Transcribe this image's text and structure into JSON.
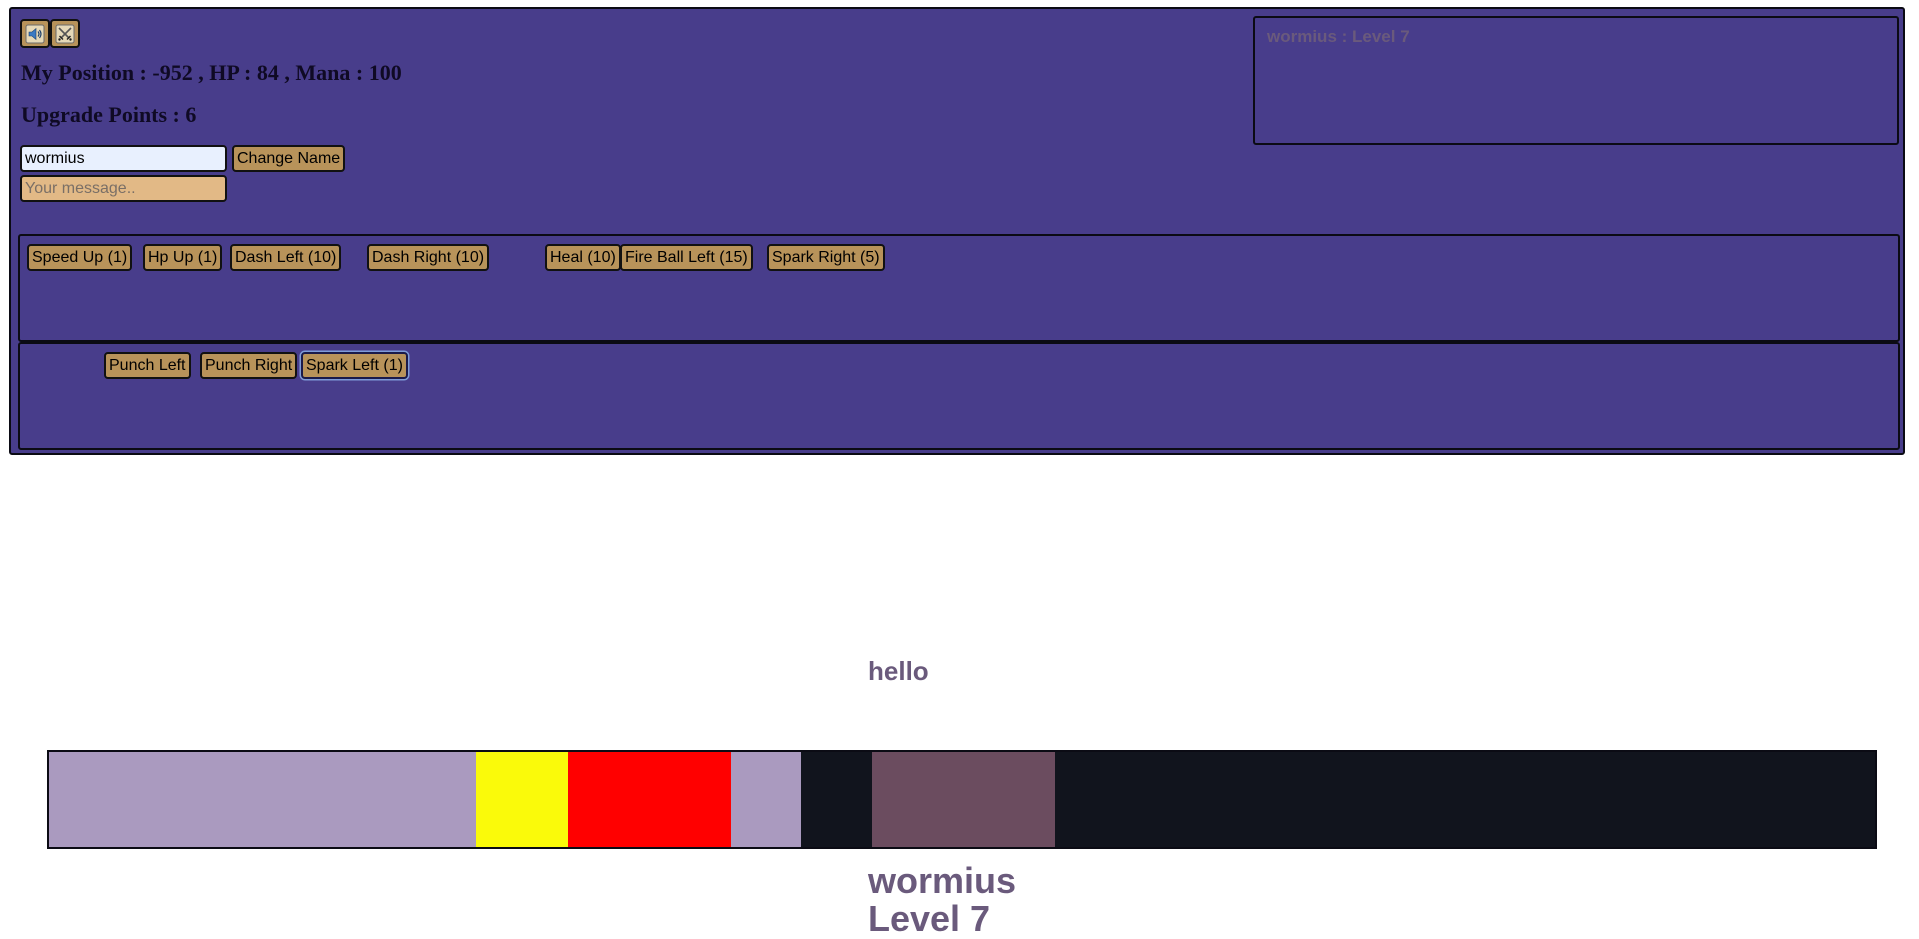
{
  "hud": {
    "sound_icon": "speaker-icon",
    "combat_icon": "crossed-swords-icon",
    "position_line": "My Position : -952 , HP : 84 , Mana : 100",
    "upgrade_line": "Upgrade Points : 6",
    "name_input_value": "wormius",
    "change_name_label": "Change Name",
    "message_placeholder": "Your message.."
  },
  "chat": {
    "lines": [
      "wormius : Level 7"
    ]
  },
  "upgrades": [
    {
      "label": "Speed Up (1)"
    },
    {
      "label": "Hp Up (1)"
    },
    {
      "label": "Dash Left (10)"
    },
    {
      "label": "Dash Right (10)"
    },
    {
      "label": "Heal (10)"
    },
    {
      "label": "Fire Ball Left (15)"
    },
    {
      "label": "Spark Right (5)"
    }
  ],
  "actions": [
    {
      "label": "Punch Left"
    },
    {
      "label": "Punch Right"
    },
    {
      "label": "Spark Left (1)"
    }
  ],
  "world": {
    "speech": "hello",
    "player_name": "wormius",
    "player_level": "Level 7",
    "colors": {
      "ground": "#11141d",
      "zone": "#aa9abf",
      "yellow": "#fafa0a",
      "red": "#ff0000",
      "player": "#6b4c5f",
      "panel": "#483d8b",
      "button": "#b8935a"
    }
  }
}
